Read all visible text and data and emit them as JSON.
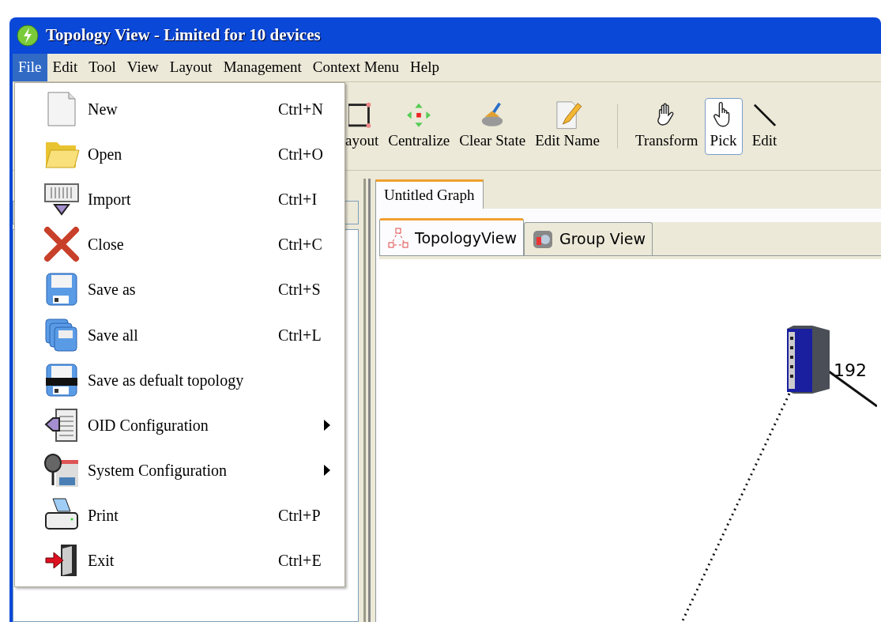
{
  "window": {
    "title": "Topology View - Limited for 10 devices"
  },
  "menubar": [
    {
      "label": "File",
      "selected": true
    },
    {
      "label": "Edit",
      "selected": false
    },
    {
      "label": "Tool",
      "selected": false
    },
    {
      "label": "View",
      "selected": false
    },
    {
      "label": "Layout",
      "selected": false
    },
    {
      "label": "Management",
      "selected": false
    },
    {
      "label": "Context Menu",
      "selected": false
    },
    {
      "label": "Help",
      "selected": false
    }
  ],
  "file_menu": [
    {
      "kind": "command",
      "label": "New",
      "shortcut": "Ctrl+N"
    },
    {
      "kind": "command",
      "label": "Open",
      "shortcut": "Ctrl+O"
    },
    {
      "kind": "command",
      "label": "Import",
      "shortcut": "Ctrl+I"
    },
    {
      "kind": "command",
      "label": "Close",
      "shortcut": "Ctrl+C"
    },
    {
      "kind": "command",
      "label": "Save as",
      "shortcut": "Ctrl+S"
    },
    {
      "kind": "command",
      "label": "Save all",
      "shortcut": "Ctrl+L"
    },
    {
      "kind": "command",
      "label": "Save as defualt topology"
    },
    {
      "kind": "submenu",
      "label": "OID Configuration"
    },
    {
      "kind": "submenu",
      "label": "System Configuration"
    },
    {
      "kind": "command",
      "label": "Print",
      "shortcut": "Ctrl+P"
    },
    {
      "kind": "command",
      "label": "Exit",
      "shortcut": "Ctrl+E"
    }
  ],
  "toolbar": [
    {
      "kind": "button",
      "label": "ayout",
      "selected": false
    },
    {
      "kind": "button",
      "label": "Centralize",
      "selected": false
    },
    {
      "kind": "button",
      "label": "Clear State",
      "selected": false
    },
    {
      "kind": "button",
      "label": "Edit Name",
      "selected": false
    },
    {
      "kind": "separator"
    },
    {
      "kind": "button",
      "label": "Transform",
      "selected": false
    },
    {
      "kind": "button",
      "label": "Pick",
      "selected": true
    },
    {
      "kind": "button",
      "label": "Edit",
      "selected": false
    }
  ],
  "document_tabs": [
    {
      "label": "Untitled Graph",
      "selected": true
    }
  ],
  "view_tabs": [
    {
      "label": "TopologyView",
      "selected": true
    },
    {
      "label": "Group View",
      "selected": false
    }
  ],
  "canvas": {
    "device_label": "192"
  }
}
